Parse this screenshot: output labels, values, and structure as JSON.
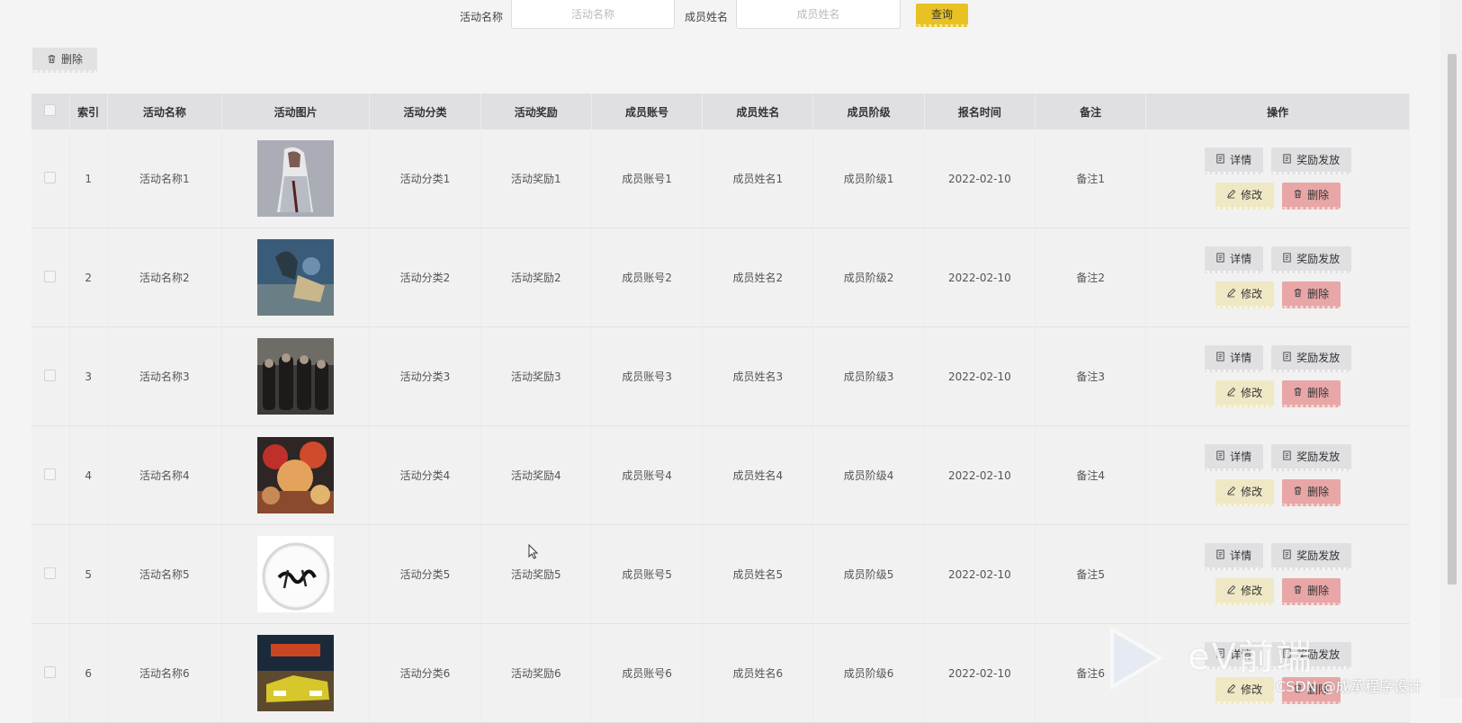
{
  "search": {
    "activity_name_label": "活动名称",
    "activity_name_placeholder": "活动名称",
    "member_name_label": "成员姓名",
    "member_name_placeholder": "成员姓名",
    "query_label": "查询"
  },
  "toolbar": {
    "delete_label": "删除"
  },
  "table": {
    "headers": [
      "",
      "索引",
      "活动名称",
      "活动图片",
      "活动分类",
      "活动奖励",
      "成员账号",
      "成员姓名",
      "成员阶级",
      "报名时间",
      "备注",
      "操作"
    ],
    "rows": [
      {
        "index": "1",
        "activity_name": "活动名称1",
        "category": "活动分类1",
        "reward": "活动奖励1",
        "account": "成员账号1",
        "member_name": "成员姓名1",
        "level": "成员阶级1",
        "signup_time": "2022-02-10",
        "remark": "备注1"
      },
      {
        "index": "2",
        "activity_name": "活动名称2",
        "category": "活动分类2",
        "reward": "活动奖励2",
        "account": "成员账号2",
        "member_name": "成员姓名2",
        "level": "成员阶级2",
        "signup_time": "2022-02-10",
        "remark": "备注2"
      },
      {
        "index": "3",
        "activity_name": "活动名称3",
        "category": "活动分类3",
        "reward": "活动奖励3",
        "account": "成员账号3",
        "member_name": "成员姓名3",
        "level": "成员阶级3",
        "signup_time": "2022-02-10",
        "remark": "备注3"
      },
      {
        "index": "4",
        "activity_name": "活动名称4",
        "category": "活动分类4",
        "reward": "活动奖励4",
        "account": "成员账号4",
        "member_name": "成员姓名4",
        "level": "成员阶级4",
        "signup_time": "2022-02-10",
        "remark": "备注4"
      },
      {
        "index": "5",
        "activity_name": "活动名称5",
        "category": "活动分类5",
        "reward": "活动奖励5",
        "account": "成员账号5",
        "member_name": "成员姓名5",
        "level": "成员阶级5",
        "signup_time": "2022-02-10",
        "remark": "备注5"
      },
      {
        "index": "6",
        "activity_name": "活动名称6",
        "category": "活动分类6",
        "reward": "活动奖励6",
        "account": "成员账号6",
        "member_name": "成员姓名6",
        "level": "成员阶级6",
        "signup_time": "2022-02-10",
        "remark": "备注6"
      }
    ],
    "actions": {
      "detail": "详情",
      "reward": "奖励发放",
      "edit": "修改",
      "delete": "删除"
    }
  },
  "watermark": {
    "brand": "eV前端",
    "csdn": "CSDN @成承程序设计"
  },
  "colors": {
    "query_button": "#e8c222",
    "edit_button": "#efe8c5",
    "delete_button": "#e8a6a6",
    "header_bg": "#e0e0e3"
  }
}
